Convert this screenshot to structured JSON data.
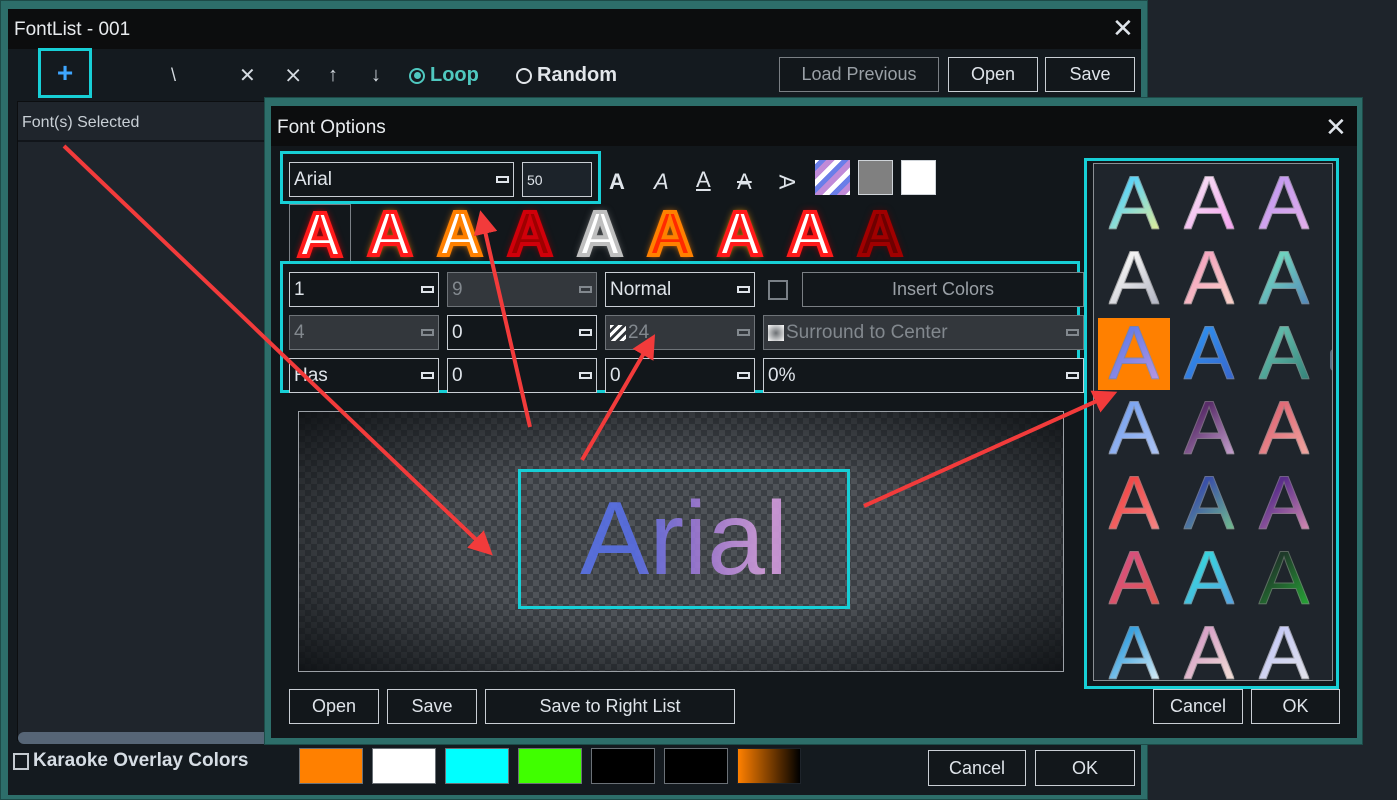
{
  "main_window": {
    "title": "FontList - 001",
    "toolbar": {
      "add_label": "+",
      "icons": [
        "edit-icon",
        "delete-icon",
        "delete-all-icon",
        "move-up-icon",
        "move-down-icon"
      ],
      "icon_glyphs": [
        "\\",
        "✕",
        "⨯",
        "↑",
        "↓"
      ],
      "loop_label": "Loop",
      "loop_selected": true,
      "random_label": "Random",
      "random_selected": false,
      "load_previous_label": "Load Previous",
      "open_label": "Open",
      "save_label": "Save"
    },
    "left_panel": {
      "header": "Font(s) Selected"
    },
    "karaoke": {
      "checked": false,
      "label": "Karaoke Overlay Colors",
      "swatches": [
        "#ff8000",
        "#ffffff",
        "#00ffff",
        "#40ff00",
        "#000000",
        "#000000",
        "gradient-orange-black"
      ]
    },
    "cancel_label": "Cancel",
    "ok_label": "OK",
    "close_glyph": "✕"
  },
  "font_options": {
    "title": "Font Options",
    "close_glyph": "✕",
    "font_name": "Arial",
    "font_size": "50",
    "format_buttons": [
      {
        "name": "bold-icon",
        "glyph": "A"
      },
      {
        "name": "italic-icon",
        "glyph": "A"
      },
      {
        "name": "underline-icon",
        "glyph": "A"
      },
      {
        "name": "strikethrough-icon",
        "glyph": "A"
      },
      {
        "name": "rotate-icon",
        "glyph": "A"
      }
    ],
    "color_swatches": [
      "gradient-blue-purple",
      "#808080",
      "#ffffff"
    ],
    "effects": [
      {
        "name": "effect-red-outline",
        "fill": "#ffffff",
        "stroke": "#ff1a1a",
        "glow": "#ff0000",
        "selected": true
      },
      {
        "name": "effect-orange-glow",
        "fill": "#ffffff",
        "stroke": "#ff1a1a",
        "glow": "#ff8000"
      },
      {
        "name": "effect-orange-fill",
        "fill": "#ffffff",
        "stroke": "#ff8000",
        "glow": "#ff8000"
      },
      {
        "name": "effect-dark-red-outline",
        "fill": "transparent",
        "stroke": "#d0000a",
        "glow": "#a00000"
      },
      {
        "name": "effect-white-shadow",
        "fill": "#ffffff",
        "stroke": "#bfbfbf",
        "glow": "#7f7f7f"
      },
      {
        "name": "effect-red-orange",
        "fill": "#ff2a00",
        "stroke": "#ff8000",
        "glow": "#ff8000"
      },
      {
        "name": "effect-white-orange-border",
        "fill": "#ffffff",
        "stroke": "#ff1a1a",
        "glow": "#ff9900"
      },
      {
        "name": "effect-white-red",
        "fill": "#ffffff",
        "stroke": "#ff1a1a",
        "glow": "#c00000"
      },
      {
        "name": "effect-maroon-outline",
        "fill": "transparent",
        "stroke": "#a00000",
        "glow": "#700000"
      }
    ],
    "params": {
      "row1": {
        "a": "1",
        "b": "9",
        "c": "Normal",
        "insert_colors_checked": false,
        "insert_colors_label": "Insert Colors"
      },
      "row2": {
        "a": "4",
        "b": "0",
        "c": "24",
        "d": "Surround to Center"
      },
      "row3": {
        "a": "Has",
        "b": "0",
        "c": "0",
        "d": "0%"
      }
    },
    "preview_text": "Arial",
    "buttons": {
      "open": "Open",
      "save": "Save",
      "save_right": "Save to Right List",
      "cancel": "Cancel",
      "ok": "OK"
    },
    "right_list": {
      "selected_index": 6,
      "items": [
        [
          "#5fd4f5",
          "#f6f08a"
        ],
        [
          "#f5d6f2",
          "#f59af0"
        ],
        [
          "#c69cf0",
          "#e8b2e8"
        ],
        [
          "#f2f2f2",
          "#a6aabb"
        ],
        [
          "#f5a8c0",
          "#f9d6c8"
        ],
        [
          "#6fd2be",
          "#4f7ab8"
        ],
        [
          "#6a7ee8",
          "#c49ae0"
        ],
        [
          "#2f8aea",
          "#3a60c8"
        ],
        [
          "#5fb8a8",
          "#2e7a72"
        ],
        [
          "#7ea6f0",
          "#b4c8f4"
        ],
        [
          "#5a2e6a",
          "#d8b4e0"
        ],
        [
          "#e06c78",
          "#f2b0a8"
        ],
        [
          "#f04a4a",
          "#f59090"
        ],
        [
          "#3a50a8",
          "#7ad08a"
        ],
        [
          "#5a2e8a",
          "#e89ab8"
        ],
        [
          "#d8507a",
          "#e05a4a"
        ],
        [
          "#3ad2de",
          "#5a9ae0"
        ],
        [
          "#1f3a2a",
          "#28b838"
        ],
        [
          "#3aa2e0",
          "#f2f8fa"
        ],
        [
          "#d8a4c8",
          "#f6e8d8"
        ],
        [
          "#c8ccf6",
          "#e6e6e6"
        ]
      ]
    }
  }
}
